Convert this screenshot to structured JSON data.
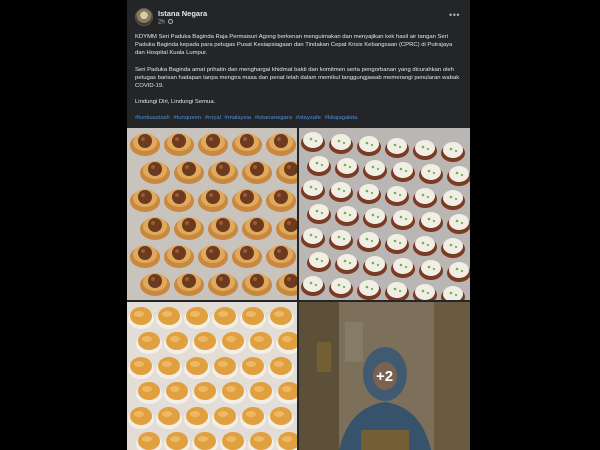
{
  "post": {
    "page_name": "Istana Negara",
    "time": "2h",
    "paragraphs": [
      "KDYMM Seri Paduka Baginda Raja Permaisuri Agong berkenan menguimakan dan menyajikan kek hasil air tangan Seri Paduka Baginda kepada para petugas Pusat Kesiapsiagaan dan Tindakan Cepat Krisis Kebangsaan (CPRC) di Putrajaya dan Hospital Kuala Lumpur.",
      "Seri Paduka Baginda amat prihatin dan menghargai khidmat bakti dan komitmen serta pengorbanan yang dicurahkan oleh petugas barisan hadapan tanpa mengira masa dan penat lelah dalam memikul tanggungjawab memerangi penularan wabak COVID-19.",
      "Lindungi Diri, Lindungi Semua."
    ],
    "hashtags": [
      "#tunkuazizah",
      "#tunqueen",
      "#royal",
      "#malaysia",
      "#istananegara",
      "#staysafe",
      "#kitajagakita"
    ]
  },
  "photos": {
    "more_count": "+2",
    "items": [
      {
        "subject": "chocolate cupcakes"
      },
      {
        "subject": "cream topped cupcakes"
      },
      {
        "subject": "plain muffins"
      },
      {
        "subject": "portrait"
      }
    ]
  },
  "colors": {
    "card_bg": "#242526",
    "text": "#e4e6eb",
    "meta": "#b0b3b8",
    "hashtag": "#4b8fe0"
  }
}
